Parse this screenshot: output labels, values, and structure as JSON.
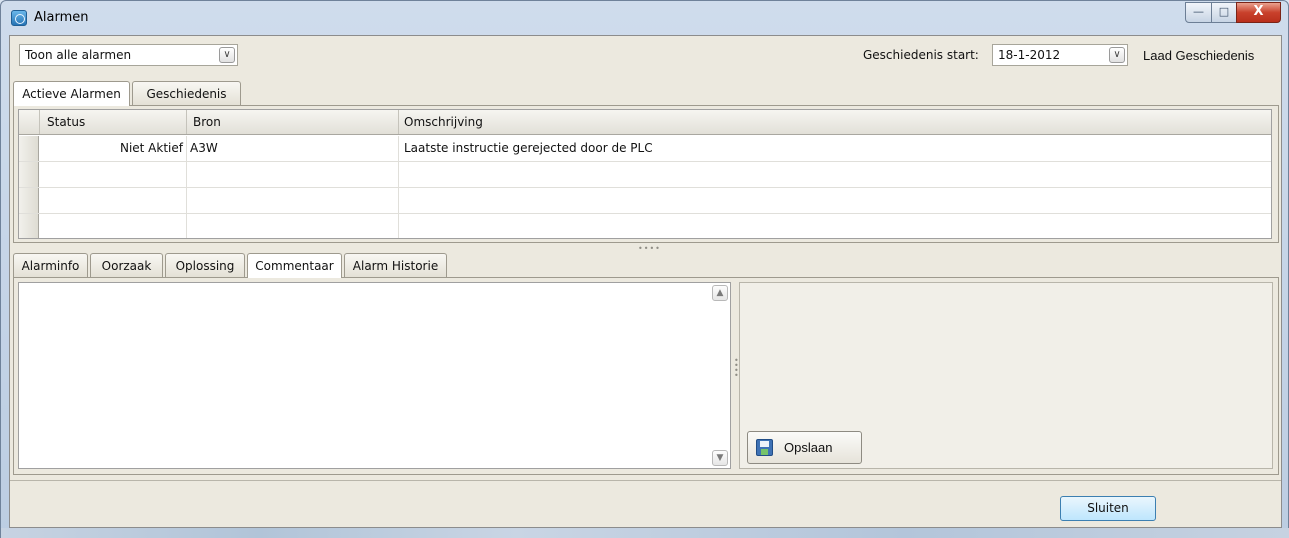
{
  "window": {
    "title": "Alarmen",
    "controls": {
      "minimize": "—",
      "maximize": "□",
      "close": "X"
    }
  },
  "toolbar": {
    "filter": {
      "selected": "Toon alle alarmen"
    },
    "history_start_label": "Geschiedenis start:",
    "history_start_date": "18-1-2012",
    "load_history_label": "Laad Geschiedenis"
  },
  "main_tabs": [
    {
      "label": "Actieve Alarmen",
      "active": true
    },
    {
      "label": "Geschiedenis",
      "active": false
    }
  ],
  "alarm_table": {
    "columns": [
      "Status",
      "Bron",
      "Omschrijving"
    ],
    "rows": [
      {
        "status": "Niet Aktief",
        "bron": "A3W",
        "omschrijving": "Laatste instructie gerejected door de PLC"
      },
      {
        "status": "",
        "bron": "",
        "omschrijving": ""
      },
      {
        "status": "",
        "bron": "",
        "omschrijving": ""
      },
      {
        "status": "",
        "bron": "",
        "omschrijving": ""
      }
    ]
  },
  "detail_tabs": [
    {
      "label": "Alarminfo",
      "active": false
    },
    {
      "label": "Oorzaak",
      "active": false
    },
    {
      "label": "Oplossing",
      "active": false
    },
    {
      "label": "Commentaar",
      "active": true
    },
    {
      "label": "Alarm Historie",
      "active": false
    }
  ],
  "comment": {
    "value": ""
  },
  "save_button": {
    "label": "Opslaan",
    "icon": "floppy-disk-icon"
  },
  "close_button": {
    "label": "Sluiten"
  }
}
